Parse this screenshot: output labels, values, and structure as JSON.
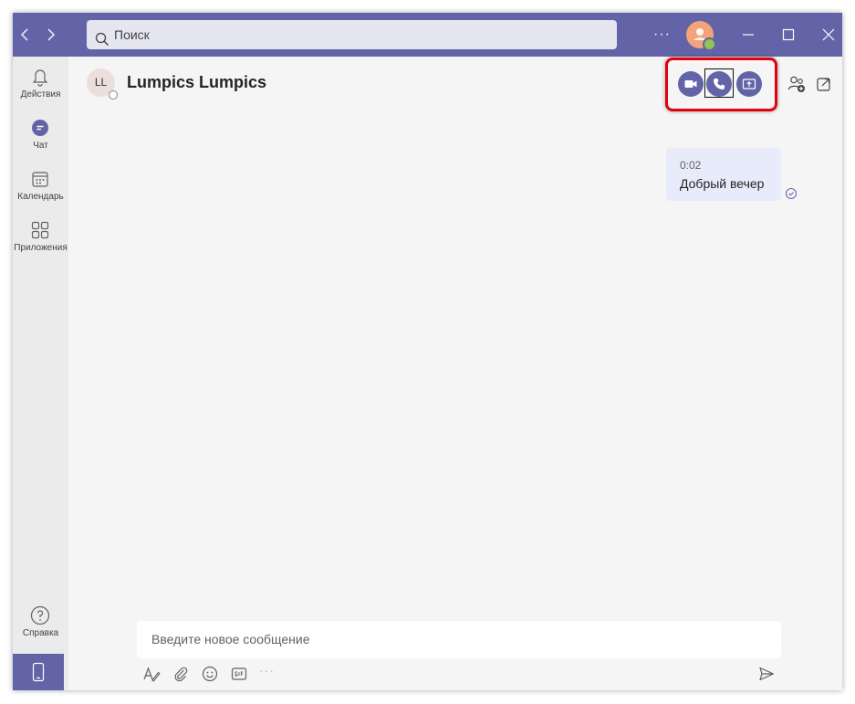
{
  "titlebar": {
    "search_placeholder": "Поиск",
    "more_label": "···"
  },
  "rail": {
    "items": [
      {
        "label": "Действия",
        "icon": "bell-icon"
      },
      {
        "label": "Чат",
        "icon": "chat-icon"
      },
      {
        "label": "Календарь",
        "icon": "calendar-icon"
      },
      {
        "label": "Приложения",
        "icon": "apps-icon"
      }
    ],
    "help_label": "Справка"
  },
  "chat": {
    "avatar_initials": "LL",
    "title": "Lumpics Lumpics"
  },
  "message": {
    "time": "0:02",
    "text": "Добрый вечер"
  },
  "compose": {
    "placeholder": "Введите новое сообщение",
    "more_label": "···"
  },
  "colors": {
    "accent": "#6264a7",
    "highlight": "#e3000f",
    "bubble": "#e8ebfa",
    "presence_available": "#92c353"
  }
}
